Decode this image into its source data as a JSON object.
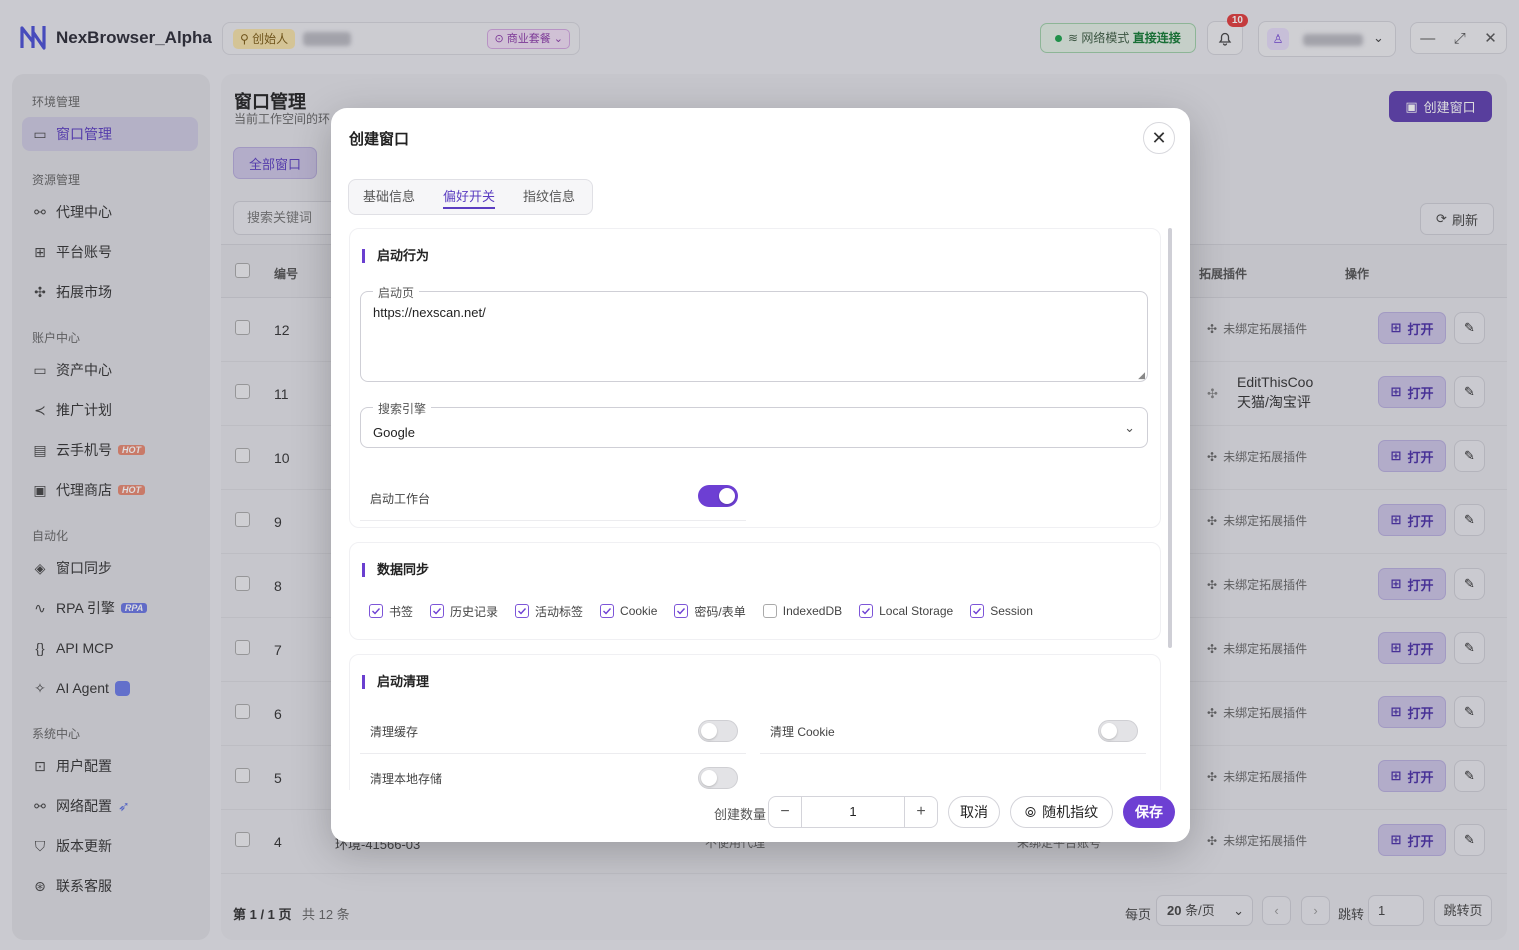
{
  "app": {
    "name": "NexBrowser_Alpha",
    "creator_badge": "创始人",
    "plan_badge": "商业套餐",
    "net_label": "网络模式",
    "net_value": "直接连接",
    "notify_count": "10"
  },
  "sidebar": {
    "sections": [
      {
        "title": "环境管理"
      },
      {
        "title": "资源管理"
      },
      {
        "title": "账户中心"
      },
      {
        "title": "自动化"
      },
      {
        "title": "系统中心"
      }
    ],
    "items": [
      {
        "label": "窗口管理"
      },
      {
        "label": "代理中心"
      },
      {
        "label": "平台账号"
      },
      {
        "label": "拓展市场"
      },
      {
        "label": "资产中心"
      },
      {
        "label": "推广计划"
      },
      {
        "label": "云手机号",
        "tag": "HOT"
      },
      {
        "label": "代理商店",
        "tag": "HOT"
      },
      {
        "label": "窗口同步"
      },
      {
        "label": "RPA 引擎",
        "tag": "RPA"
      },
      {
        "label": "API MCP"
      },
      {
        "label": "AI Agent"
      },
      {
        "label": "用户配置"
      },
      {
        "label": "网络配置"
      },
      {
        "label": "版本更新"
      },
      {
        "label": "联系客服"
      }
    ]
  },
  "main": {
    "title": "窗口管理",
    "subtitle": "当前工作空间的环",
    "create_button": "创建窗口",
    "tab_all": "全部窗口",
    "search_placeholder": "搜索关键词",
    "refresh": "刷新",
    "columns": {
      "num": "编号",
      "ext": "拓展插件",
      "op": "操作"
    },
    "rows": [
      {
        "num": "12",
        "ext": "未绑定拓展插件"
      },
      {
        "num": "11",
        "ext1": "EditThisCoo",
        "ext2": "天猫/淘宝评"
      },
      {
        "num": "10",
        "ext": "未绑定拓展插件"
      },
      {
        "num": "9",
        "ext": "未绑定拓展插件"
      },
      {
        "num": "8",
        "ext": "未绑定拓展插件"
      },
      {
        "num": "7",
        "ext": "未绑定拓展插件"
      },
      {
        "num": "6",
        "ext": "未绑定拓展插件"
      },
      {
        "num": "5",
        "ext": "未绑定拓展插件"
      },
      {
        "num": "4",
        "ext": "未绑定拓展插件",
        "env": "环境-41566-03",
        "proxy": "不使用代理",
        "platform": "未绑定平台账号"
      }
    ],
    "open_label": "打开",
    "footer": {
      "page": "第 1 / 1 页",
      "total": "共 12 条",
      "per_page_label": "每页",
      "per_page": "20",
      "per_page_unit": "条/页",
      "jump_label": "跳转",
      "jump_value": "1",
      "jump_button": "跳转页"
    }
  },
  "modal": {
    "title": "创建窗口",
    "tabs": [
      "基础信息",
      "偏好开关",
      "指纹信息"
    ],
    "active_tab": "偏好开关",
    "startup": {
      "section": "启动行为",
      "home_legend": "启动页",
      "home_value": "https://nexscan.net/",
      "engine_legend": "搜索引擎",
      "engine_value": "Google",
      "workbench_label": "启动工作台"
    },
    "sync": {
      "section": "数据同步",
      "items": [
        {
          "label": "书签",
          "checked": true
        },
        {
          "label": "历史记录",
          "checked": true
        },
        {
          "label": "活动标签",
          "checked": true
        },
        {
          "label": "Cookie",
          "checked": true
        },
        {
          "label": "密码/表单",
          "checked": true
        },
        {
          "label": "IndexedDB",
          "checked": false
        },
        {
          "label": "Local Storage",
          "checked": true
        },
        {
          "label": "Session",
          "checked": true
        }
      ]
    },
    "clean": {
      "section": "启动清理",
      "cache": "清理缓存",
      "cookie": "清理 Cookie",
      "local": "清理本地存储"
    },
    "footer": {
      "count_label": "创建数量",
      "count": "1",
      "cancel": "取消",
      "random": "随机指纹",
      "save": "保存"
    }
  }
}
